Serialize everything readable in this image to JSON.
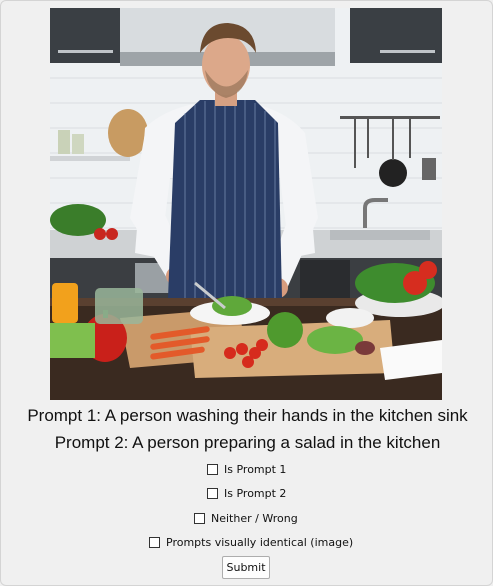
{
  "image": {
    "icon": "kitchen-photo"
  },
  "prompts": {
    "prompt1": "Prompt 1: A person washing their hands in the kitchen sink",
    "prompt2": "Prompt 2: A person preparing a salad in the kitchen"
  },
  "options": [
    {
      "label": "Is Prompt 1",
      "checked": false
    },
    {
      "label": "Is Prompt 2",
      "checked": false
    },
    {
      "label": "Neither / Wrong",
      "checked": false
    },
    {
      "label": "Prompts visually identical (image)",
      "checked": false
    }
  ],
  "submit_label": "Submit"
}
